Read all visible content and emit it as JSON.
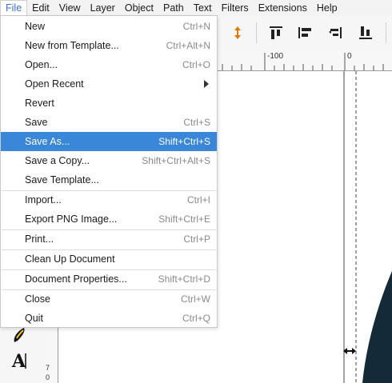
{
  "menubar": {
    "items": [
      {
        "label": "File"
      },
      {
        "label": "Edit"
      },
      {
        "label": "View"
      },
      {
        "label": "Layer"
      },
      {
        "label": "Object"
      },
      {
        "label": "Path"
      },
      {
        "label": "Text"
      },
      {
        "label": "Filters"
      },
      {
        "label": "Extensions"
      },
      {
        "label": "Help"
      }
    ]
  },
  "file_menu": {
    "items": [
      {
        "label": "New",
        "shortcut": "Ctrl+N"
      },
      {
        "label": "New from Template...",
        "shortcut": "Ctrl+Alt+N"
      },
      {
        "label": "Open...",
        "shortcut": "Ctrl+O"
      },
      {
        "label": "Open Recent",
        "shortcut": ""
      },
      {
        "label": "Revert",
        "shortcut": ""
      },
      {
        "label": "Save",
        "shortcut": "Ctrl+S"
      },
      {
        "label": "Save As...",
        "shortcut": "Shift+Ctrl+S"
      },
      {
        "label": "Save a Copy...",
        "shortcut": "Shift+Ctrl+Alt+S"
      },
      {
        "label": "Save Template...",
        "shortcut": ""
      },
      {
        "label": "Import...",
        "shortcut": "Ctrl+I"
      },
      {
        "label": "Export PNG Image...",
        "shortcut": "Shift+Ctrl+E"
      },
      {
        "label": "Print...",
        "shortcut": "Ctrl+P"
      },
      {
        "label": "Clean Up Document",
        "shortcut": ""
      },
      {
        "label": "Document Properties...",
        "shortcut": "Shift+Ctrl+D"
      },
      {
        "label": "Close",
        "shortcut": "Ctrl+W"
      },
      {
        "label": "Quit",
        "shortcut": "Ctrl+Q"
      }
    ],
    "highlighted": "Save As..."
  },
  "ruler": {
    "h_labels": [
      "-100",
      "0"
    ],
    "v_labels": [
      "7",
      "0"
    ]
  },
  "colors": {
    "highlight": "#3a86d8",
    "active_menu_text": "#3a6fd8",
    "canvas_shape": "#152a38",
    "snap_icon": "#e07a00"
  },
  "icons": {
    "toolbar": [
      "snap-arrows-icon",
      "align-top-icon",
      "align-center-vertical-icon",
      "align-left-edge-icon",
      "align-bottom-icon"
    ],
    "toolbox": [
      "calligraphy-pen-icon",
      "text-tool-icon"
    ],
    "canvas": [
      "resize-arrows-icon"
    ]
  }
}
